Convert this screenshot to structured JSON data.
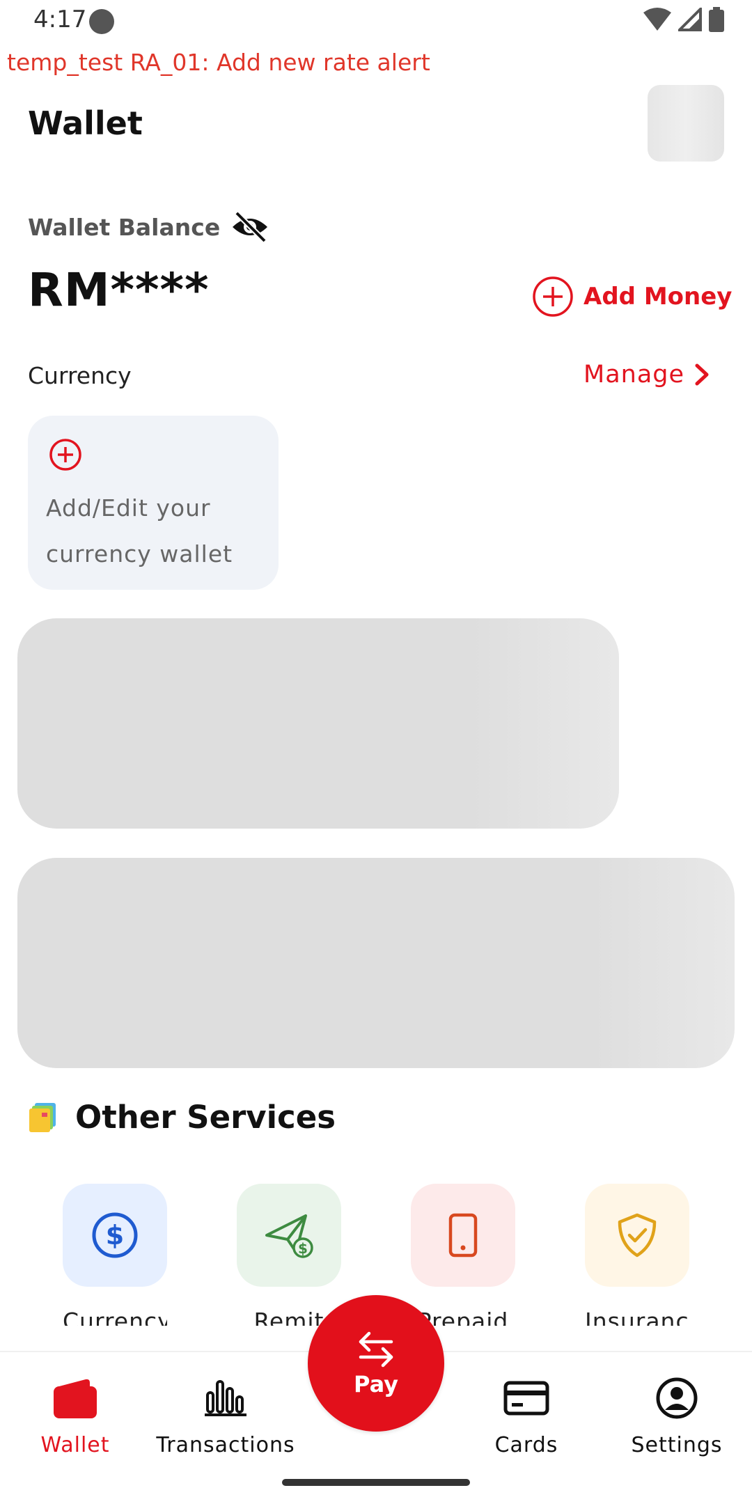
{
  "status_bar": {
    "time": "4:17"
  },
  "debug_banner": "temp_test RA_01: Add new rate alert",
  "header": {
    "title": "Wallet"
  },
  "balance": {
    "label": "Wallet Balance",
    "amount": "RM****",
    "add_money_label": "Add Money"
  },
  "currency": {
    "label": "Currency",
    "manage_label": "Manage",
    "add_card_text": "Add/Edit your currency wallet"
  },
  "other_services": {
    "title": "Other Services",
    "items": [
      {
        "label": "Currency",
        "icon": "dollar-circle-icon",
        "color": "#1f5bd0"
      },
      {
        "label": "Remit",
        "icon": "send-money-icon",
        "color": "#3d8b40"
      },
      {
        "label": "Prepaid",
        "icon": "phone-icon",
        "color": "#d8481f"
      },
      {
        "label": "Insurance",
        "icon": "shield-check-icon",
        "color": "#e0a21a"
      }
    ]
  },
  "bottom_nav": {
    "items": [
      {
        "label": "Wallet",
        "icon": "wallet-icon",
        "active": true
      },
      {
        "label": "Transactions",
        "icon": "bar-chart-icon",
        "active": false
      },
      {
        "label": "Cards",
        "icon": "card-icon",
        "active": false
      },
      {
        "label": "Settings",
        "icon": "user-circle-icon",
        "active": false
      }
    ],
    "pay_label": "Pay"
  },
  "colors": {
    "accent": "#e2141f",
    "skeleton": "#dedede",
    "card_bg": "#f0f3f8"
  }
}
